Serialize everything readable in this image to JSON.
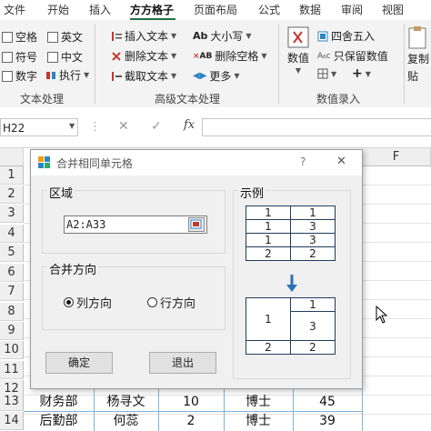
{
  "ribbon": {
    "tabs": [
      {
        "label": "文件"
      },
      {
        "label": "开始"
      },
      {
        "label": "插入"
      },
      {
        "label": "方方格子"
      },
      {
        "label": "页面布局"
      },
      {
        "label": "公式"
      },
      {
        "label": "数据"
      },
      {
        "label": "审阅"
      },
      {
        "label": "视图"
      }
    ],
    "text_group": {
      "checkboxes": [
        {
          "label": "空格"
        },
        {
          "label": "英文"
        },
        {
          "label": "符号"
        },
        {
          "label": "中文"
        },
        {
          "label": "数字"
        }
      ],
      "execute": "执行",
      "label": "文本处理"
    },
    "adv_group": {
      "insert_text": "插入文本",
      "delete_text": "删除文本",
      "extract_text": "截取文本",
      "case": "大小写",
      "delete_spaces": "删除空格",
      "more": "更多",
      "label": "高级文本处理"
    },
    "num_group": {
      "value": "数值",
      "round": "四舍五入",
      "keep_value": "只保留数值",
      "plus": "+",
      "label": "数值录入"
    },
    "right_group": {
      "label_top": "复制",
      "label_bottom": "贴"
    }
  },
  "formula_bar": {
    "name_box": "H22",
    "cancel": "✕",
    "confirm": "✓",
    "fx": "fx"
  },
  "grid": {
    "col_f": "F",
    "rows": [
      "1",
      "2",
      "3",
      "4",
      "5",
      "6",
      "7",
      "8",
      "9",
      "10",
      "11",
      "12",
      "13",
      "14"
    ],
    "data_rows": [
      [
        "财务部",
        "杨寻文",
        "10",
        "博士",
        "45"
      ],
      [
        "后勤部",
        "何蕊",
        "2",
        "博士",
        "39"
      ]
    ]
  },
  "dialog": {
    "title": "合并相同单元格",
    "help": "?",
    "close": "✕",
    "range_legend": "区域",
    "range_value": "A2:A33",
    "direction_legend": "合并方向",
    "col_dir": "列方向",
    "row_dir": "行方向",
    "ok": "确定",
    "exit": "退出",
    "example_legend": "示例",
    "example_before": [
      [
        "1",
        "1"
      ],
      [
        "1",
        "3"
      ],
      [
        "1",
        "3"
      ],
      [
        "2",
        "2"
      ]
    ],
    "example_after": {
      "merged": "1",
      "right": [
        "1",
        "3"
      ],
      "last": [
        "2",
        "2"
      ]
    }
  }
}
